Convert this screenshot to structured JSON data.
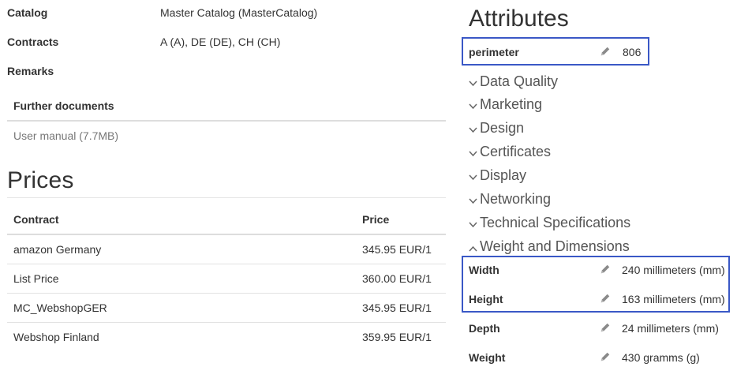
{
  "details": {
    "catalog_label": "Catalog",
    "catalog_value": "Master Catalog (MasterCatalog)",
    "contracts_label": "Contracts",
    "contracts_value": "A (A), DE (DE), CH (CH)",
    "remarks_label": "Remarks"
  },
  "documents": {
    "header": "Further documents",
    "items": [
      "User manual (7.7MB)"
    ]
  },
  "prices": {
    "title": "Prices",
    "columns": [
      "Contract",
      "Price"
    ],
    "rows": [
      {
        "contract": "amazon Germany",
        "price": "345.95 EUR/1"
      },
      {
        "contract": "List Price",
        "price": "360.00 EUR/1"
      },
      {
        "contract": "MC_WebshopGER",
        "price": "345.95 EUR/1"
      },
      {
        "contract": "Webshop Finland",
        "price": "359.95 EUR/1"
      }
    ]
  },
  "attributes": {
    "title": "Attributes",
    "perimeter": {
      "label": "perimeter",
      "value": "806",
      "icon": "pencil-icon"
    },
    "groups": [
      {
        "label": "Data Quality",
        "expanded": false
      },
      {
        "label": "Marketing",
        "expanded": false
      },
      {
        "label": "Design",
        "expanded": false
      },
      {
        "label": "Certificates",
        "expanded": false
      },
      {
        "label": "Display",
        "expanded": false
      },
      {
        "label": "Networking",
        "expanded": false
      },
      {
        "label": "Technical Specifications",
        "expanded": false
      },
      {
        "label": "Weight and Dimensions",
        "expanded": true
      }
    ],
    "weight_dimensions": [
      {
        "label": "Width",
        "value": "240 millimeters (mm)",
        "icon": "pencil-icon"
      },
      {
        "label": "Height",
        "value": "163 millimeters (mm)",
        "icon": "pencil-icon"
      },
      {
        "label": "Depth",
        "value": "24 millimeters (mm)",
        "icon": "pencil-icon"
      },
      {
        "label": "Weight",
        "value": "430 gramms (g)",
        "icon": "pencil-icon"
      }
    ]
  },
  "colors": {
    "highlight_border": "#3a58c6",
    "text": "#333333",
    "muted": "#777777"
  }
}
